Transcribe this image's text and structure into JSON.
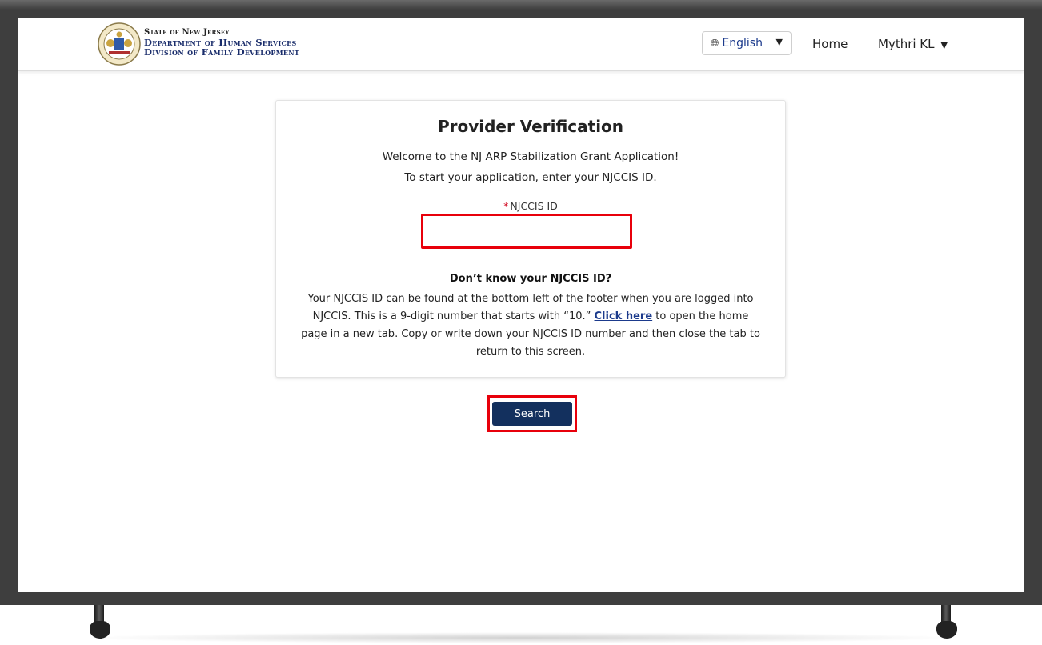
{
  "header": {
    "agency_line1": "State of New Jersey",
    "agency_line2": "Department of Human Services",
    "agency_line3": "Division of Family Development",
    "language_label": "English",
    "home_link": "Home",
    "user_name": "Mythri KL",
    "globe_icon": "globe-icon",
    "caret_icon": "caret-down-icon"
  },
  "card": {
    "title": "Provider Verification",
    "welcome": "Welcome to the NJ ARP Stabilization Grant Application!",
    "instruction": "To start your application, enter your NJCCIS ID.",
    "field_label": "NJCCIS ID",
    "required_marker": "*",
    "input_value": "",
    "help_heading": "Don’t know your NJCCIS ID?",
    "help_text_before_link": "Your NJCCIS ID can be found at the bottom left of the footer when you are logged into NJCCIS. This is a 9-digit number that starts with “10.” ",
    "help_link": "Click here",
    "help_text_after_link": " to open the home page in a new tab. Copy or write down your NJCCIS ID number and then close the tab to return to this screen."
  },
  "search_button": "Search",
  "colors": {
    "highlight": "#e8000b",
    "primary_button": "#13305e",
    "link": "#1b3a8c",
    "required": "#d0021b"
  }
}
